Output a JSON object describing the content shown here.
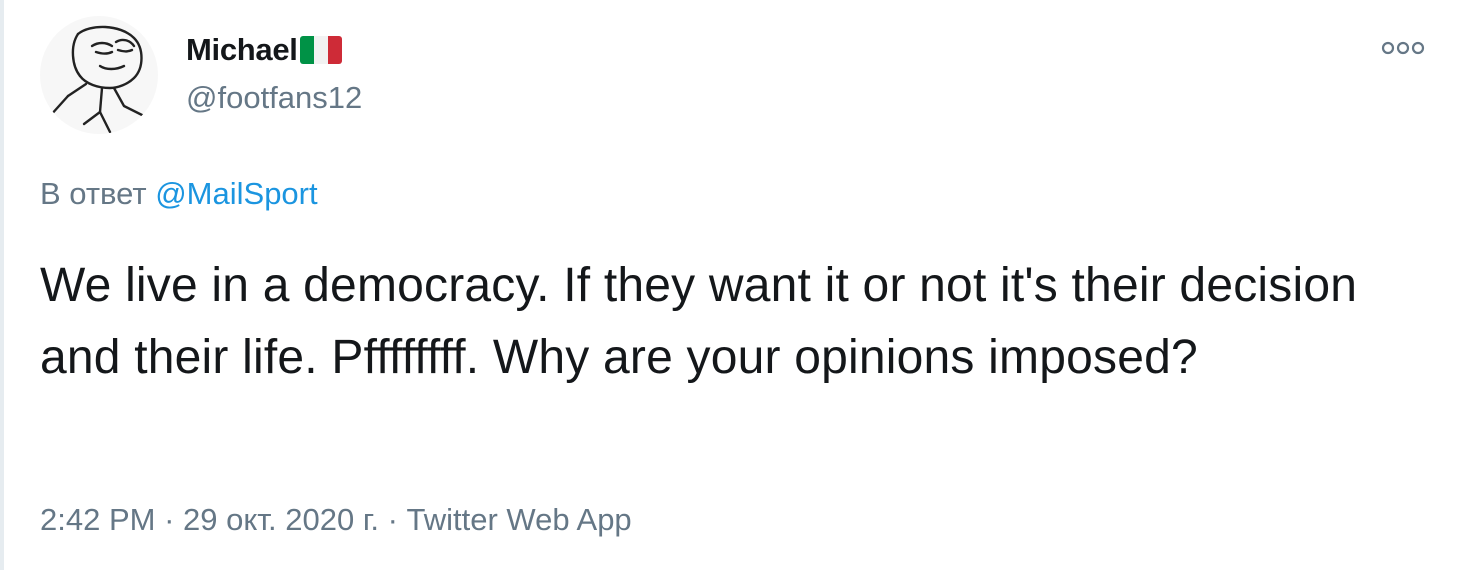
{
  "author": {
    "display_name": "Michael",
    "flag_icon": "italy-flag-icon",
    "flag_colors": [
      "#009246",
      "#ffffff",
      "#ce2b37"
    ],
    "handle": "@footfans12"
  },
  "reply": {
    "prefix": "В ответ",
    "mention": "@MailSport"
  },
  "tweet": {
    "text": "We live in a democracy. If they want it or not it's their decision and their life. Pffffffff. Why are your opinions imposed?"
  },
  "meta": {
    "time": "2:42 PM",
    "separator": " · ",
    "date": "29 окт. 2020 г.",
    "source": "Twitter Web App"
  },
  "actions": {
    "more_icon": "more-options-icon"
  },
  "colors": {
    "text": "#14171a",
    "secondary": "#657786",
    "link": "#1b95e0"
  }
}
